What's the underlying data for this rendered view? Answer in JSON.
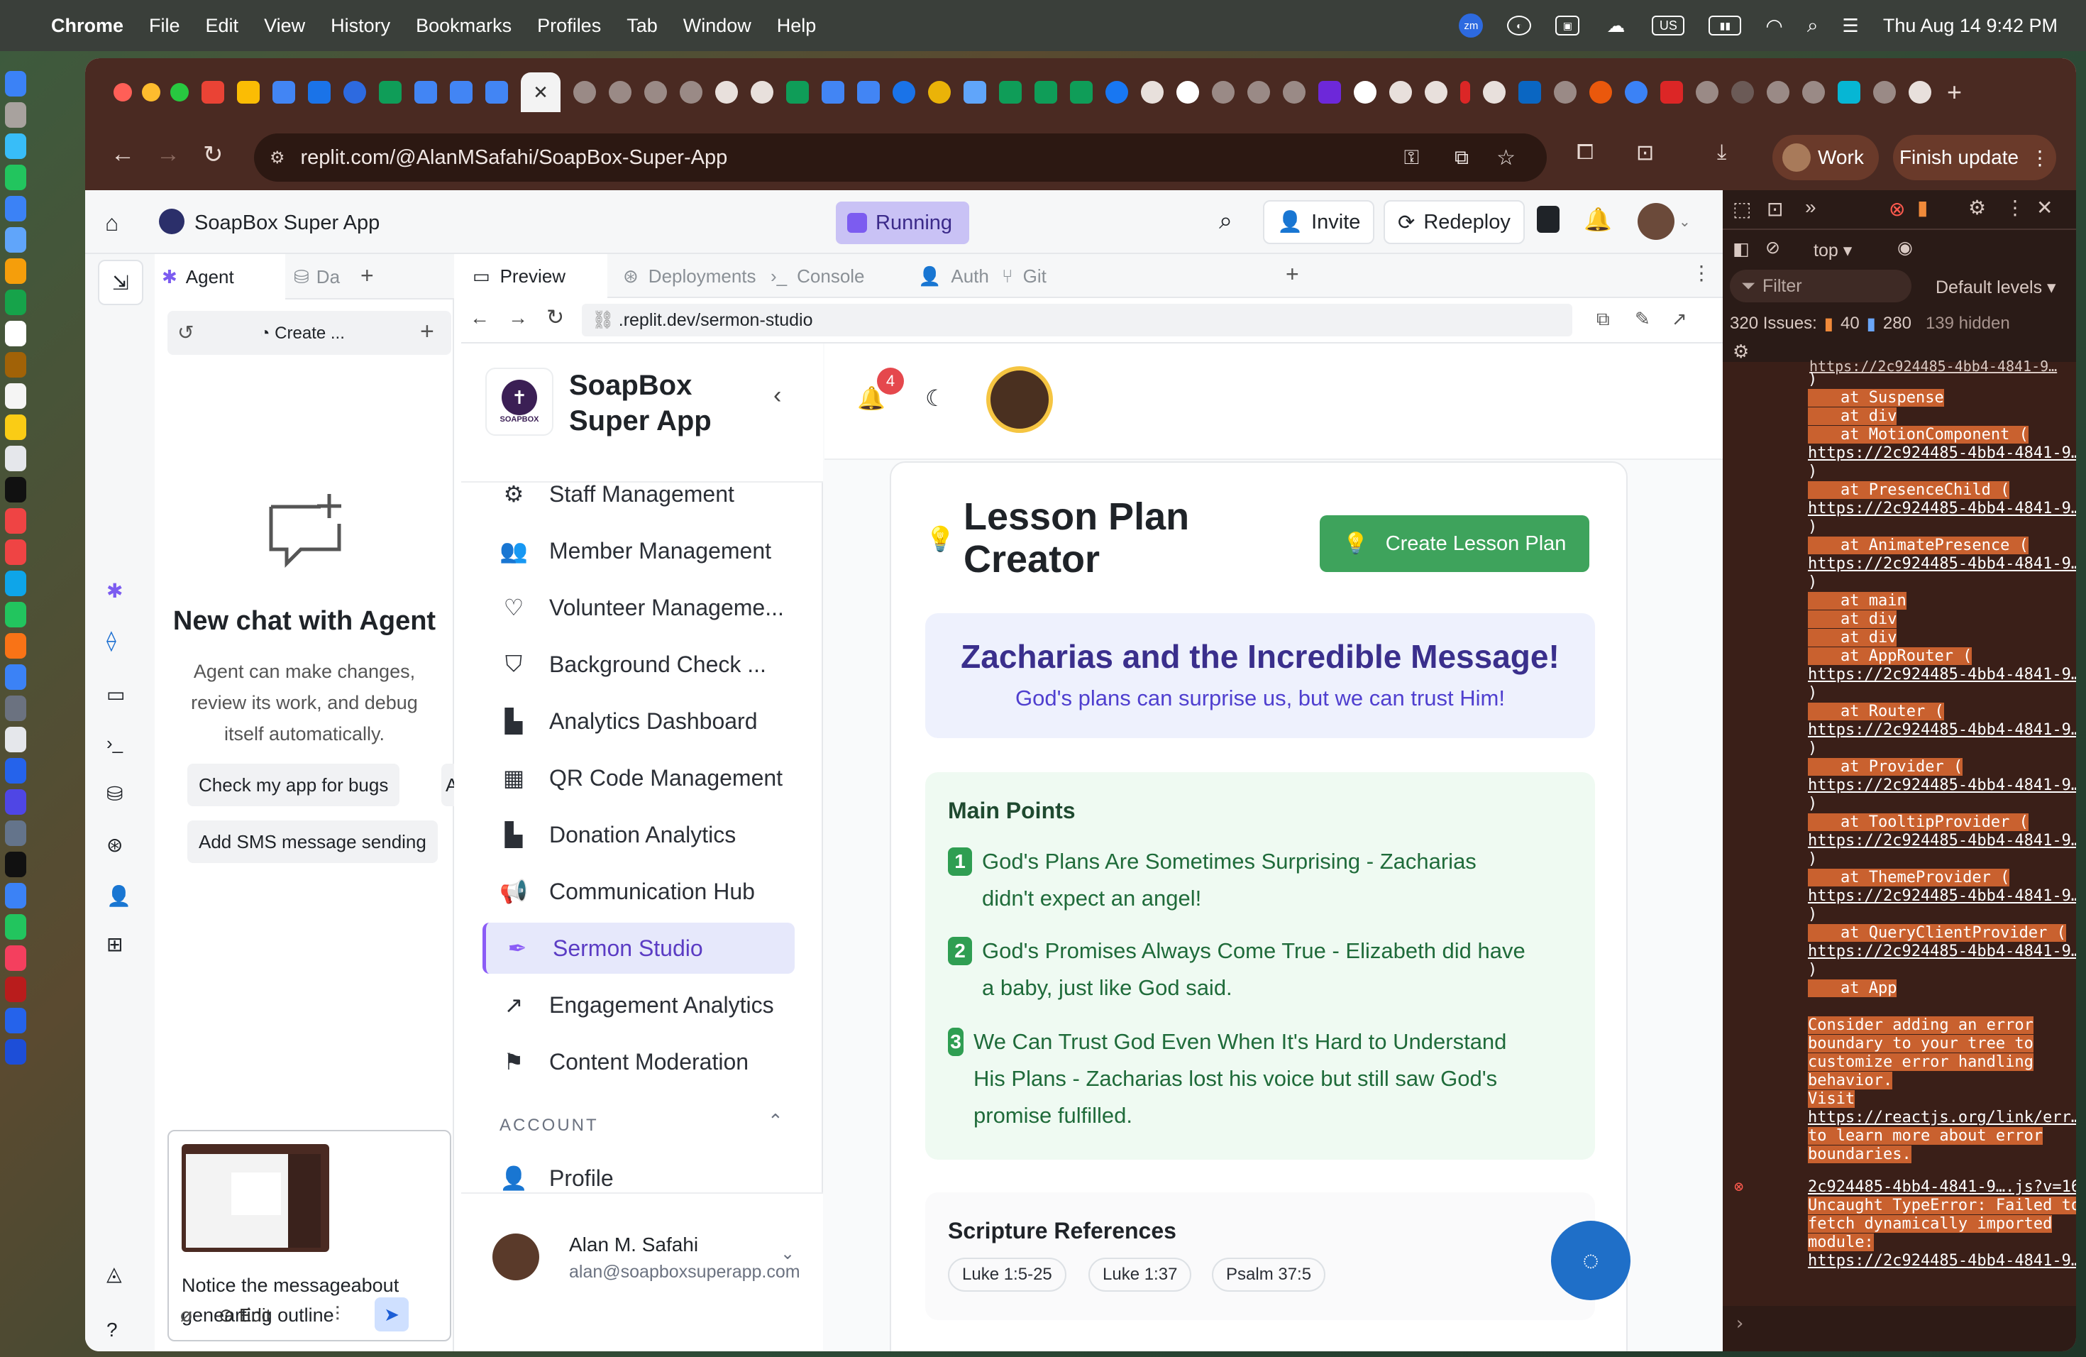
{
  "menubar": {
    "app": "Chrome",
    "items": [
      "File",
      "Edit",
      "View",
      "History",
      "Bookmarks",
      "Profiles",
      "Tab",
      "Window",
      "Help"
    ],
    "zoom_badge": "zm",
    "input_source": "US",
    "clock": "Thu Aug 14  9:42 PM"
  },
  "browser": {
    "url": "replit.com/@AlanMSafahi/SoapBox-Super-App",
    "profile_label": "Work",
    "update_label": "Finish update"
  },
  "replit": {
    "project_name": "SoapBox Super App",
    "run_status": "Running",
    "invite_label": "Invite",
    "redeploy_label": "Redeploy",
    "left_tabs": {
      "agent": "Agent",
      "db": "Da"
    },
    "agent_toolbar": {
      "create_label": "Create ..."
    },
    "agent": {
      "title": "New chat with Agent",
      "description": "Agent can make changes, review its work, and debug itself automatically.",
      "suggestions": [
        "Check my app for bugs",
        "A",
        "Add SMS message sending"
      ],
      "input_text": "Notice the messageabout genearting outline",
      "edit_label": "Edit"
    },
    "preview_tabs": {
      "preview": "Preview",
      "deployments": "Deployments",
      "console": "Console",
      "auth": "Auth",
      "git": "Git"
    },
    "preview_url": ".replit.dev/sermon-studio"
  },
  "app": {
    "brand_line1": "SoapBox",
    "brand_line2": "Super App",
    "logo_text": "SOAPBOX",
    "notification_count": "4",
    "nav": [
      {
        "label": "Staff Management",
        "icon": "user-cog-icon"
      },
      {
        "label": "Member Management",
        "icon": "users-icon"
      },
      {
        "label": "Volunteer Manageme...",
        "icon": "hand-heart-icon"
      },
      {
        "label": "Background Check ...",
        "icon": "shield-icon"
      },
      {
        "label": "Analytics Dashboard",
        "icon": "bar-chart-icon"
      },
      {
        "label": "QR Code Management",
        "icon": "qr-code-icon"
      },
      {
        "label": "Donation Analytics",
        "icon": "bar-chart-icon"
      },
      {
        "label": "Communication Hub",
        "icon": "megaphone-icon"
      },
      {
        "label": "Sermon Studio",
        "icon": "pen-tool-icon",
        "active": true
      },
      {
        "label": "Engagement Analytics",
        "icon": "trending-up-icon"
      },
      {
        "label": "Content Moderation",
        "icon": "flag-icon"
      }
    ],
    "account_section": "ACCOUNT",
    "profile_label": "Profile",
    "user": {
      "name": "Alan M. Safahi",
      "email": "alan@soapboxsuperapp.com"
    },
    "lesson": {
      "title_line1": "Lesson Plan",
      "title_line2": "Creator",
      "create_button": "Create Lesson Plan",
      "headline": "Zacharias and the Incredible Message!",
      "subheadline": "God's plans can surprise us, but we can trust Him!",
      "main_points_title": "Main Points",
      "points": [
        {
          "n": "1",
          "line1": "God's Plans Are Sometimes Surprising - Zacharias",
          "line2": "didn't expect an angel!"
        },
        {
          "n": "2",
          "line1": "God's Promises Always Come True - Elizabeth did have",
          "line2": "a baby, just like God said."
        },
        {
          "n": "3",
          "line1": "We Can Trust God Even When It's Hard to Understand",
          "line2": "His Plans - Zacharias lost his voice but still saw God's",
          "line3": "promise fulfilled."
        }
      ],
      "scripture_title": "Scripture References",
      "scripture_refs": [
        "Luke 1:5-25",
        "Luke 1:37",
        "Psalm 37:5"
      ]
    }
  },
  "devtools": {
    "context": "top",
    "filter_placeholder": "Filter",
    "levels": "Default levels",
    "issues_label": "320 Issues:",
    "issues_warn": "40",
    "issues_info": "280",
    "hidden": "139 hidden",
    "link_text": "https://2c924485-4bb4-4841-9…",
    "top_cut_link": "https://2c924485-4bb4-4841-9…",
    "frames": [
      "at Suspense",
      "at div",
      "at MotionComponent (",
      "at PresenceChild (",
      "at AnimatePresence (",
      "at main",
      "at div",
      "at div",
      "at AppRouter (",
      "at Router (",
      "at Provider (",
      "at TooltipProvider (",
      "at ThemeProvider (",
      "at QueryClientProvider (",
      "at App"
    ],
    "advice": [
      "Consider adding an error",
      "boundary to your tree to",
      "customize error handling",
      "behavior.",
      "Visit",
      "https://reactjs.org/link/err…",
      "to learn more about error",
      "boundaries."
    ],
    "error_source": "2c924485-4bb4-4841-9….js?v=16…",
    "error_lines": [
      "Uncaught TypeError: Failed to",
      "fetch dynamically imported",
      "module:",
      "https://2c924485-4bb4-4841-9…"
    ],
    "prompt": "›"
  }
}
